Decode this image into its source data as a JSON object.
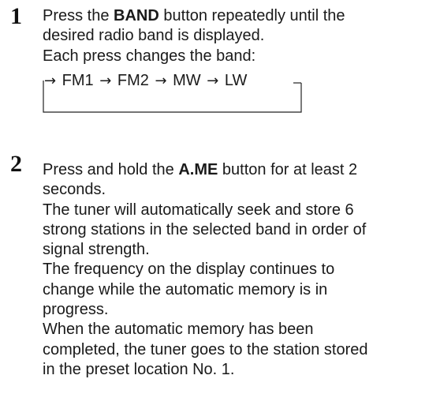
{
  "step1": {
    "number": "1",
    "line1_before": "Press the ",
    "line1_bold": "BAND",
    "line1_after": " button repeatedly until the",
    "line2": "desired radio band is displayed.",
    "line3": "Each press changes the band:",
    "cycle": {
      "arrow": "→",
      "bands": [
        "FM1",
        "FM2",
        "MW",
        "LW"
      ]
    }
  },
  "step2": {
    "number": "2",
    "line1_before": "Press and hold the ",
    "line1_bold": "A.ME",
    "line1_after": " button for at least 2",
    "lines": [
      "seconds.",
      "The tuner will automatically seek and store 6",
      "strong stations in the selected band in order of",
      "signal strength.",
      "The frequency on the display continues to",
      "change while the automatic memory is in",
      "progress.",
      "When the automatic memory has been",
      "completed, the tuner goes to the station stored",
      "in the preset location No. 1."
    ]
  }
}
